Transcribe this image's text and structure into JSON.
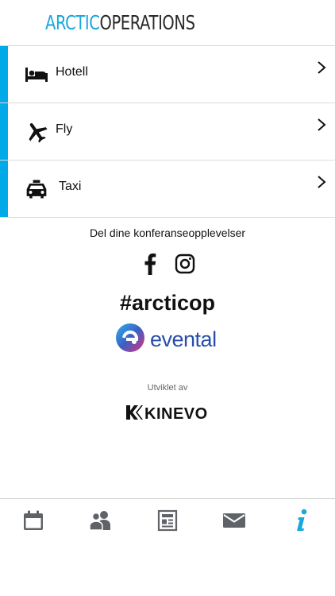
{
  "header": {
    "logo_part1": "ARCTIC",
    "logo_part2": "OPERATIONS",
    "logo_color_primary": "#1aa7dd",
    "logo_color_secondary": "#2a2a2a"
  },
  "list": {
    "accent_color": "#00a9e8",
    "items": [
      {
        "label": "Hotell",
        "icon": "bed-icon"
      },
      {
        "label": "Fly",
        "icon": "airplane-icon"
      },
      {
        "label": "Taxi",
        "icon": "taxi-icon"
      }
    ]
  },
  "social": {
    "share_text": "Del dine konferanseopplevelser",
    "icons": [
      "facebook-icon",
      "instagram-icon"
    ],
    "hashtag": "#arcticop"
  },
  "brands": {
    "evental": "evental",
    "developed_by": "Utviklet av",
    "kinevo": "KINEVO"
  },
  "bottom_nav": {
    "items": [
      {
        "icon": "calendar-icon"
      },
      {
        "icon": "people-icon"
      },
      {
        "icon": "document-icon"
      },
      {
        "icon": "mail-icon"
      },
      {
        "icon": "info-icon",
        "active": true
      }
    ],
    "active_color": "#1aa7dd",
    "inactive_color": "#5f6368"
  }
}
